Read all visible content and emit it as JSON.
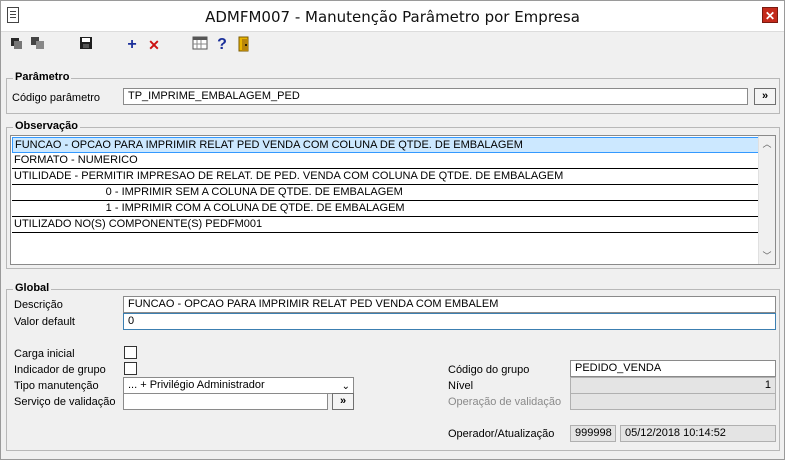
{
  "window": {
    "title": "ADMFM007 - Manutenção Parâmetro por Empresa",
    "close_glyph": "✕"
  },
  "toolbar": {
    "icons": [
      "first-record-icon",
      "copy-icon",
      "save-icon",
      "add-icon",
      "delete-icon",
      "calendar-icon",
      "help-icon",
      "exit-door-icon"
    ],
    "add_glyph": "+",
    "delete_glyph": "✕",
    "help_glyph": "?"
  },
  "parametro": {
    "group_label": "Parâmetro",
    "codigo_label": "Código parâmetro",
    "codigo_value": "TP_IMPRIME_EMBALAGEM_PED",
    "lookup_label": "»"
  },
  "observacao": {
    "group_label": "Observação",
    "rows": [
      "FUNCAO - OPCAO PARA IMPRIMIR RELAT  PED VENDA COM COLUNA DE QTDE. DE EMBALAGEM",
      "FORMATO - NUMERICO",
      "UTILIDADE - PERMITIR IMPRESAO DE RELAT. DE PED. VENDA COM COLUNA DE QTDE. DE EMBALAGEM",
      "                              0 - IMPRIMIR SEM A COLUNA DE QTDE. DE EMBALAGEM",
      "                              1 - IMPRIMIR COM A COLUNA DE QTDE. DE EMBALAGEM",
      "UTILIZADO NO(S) COMPONENTE(S) PEDFM001"
    ],
    "scroll_up": "︿",
    "scroll_down": "﹀"
  },
  "global": {
    "group_label": "Global",
    "descricao_label": "Descrição",
    "descricao_value": "FUNCAO - OPCAO PARA IMPRIMIR RELAT  PED VENDA COM EMBALEM",
    "valor_default_label": "Valor default",
    "valor_default_value": "0",
    "carga_inicial_label": "Carga inicial",
    "indicador_grupo_label": "Indicador de grupo",
    "tipo_manutencao_label": "Tipo manutenção",
    "tipo_manutencao_value": "... + Privilégio Administrador",
    "servico_validacao_label": "Serviço de validação",
    "servico_validacao_value": "",
    "servico_lookup_label": "»",
    "codigo_grupo_label": "Código do grupo",
    "codigo_grupo_value": "PEDIDO_VENDA",
    "nivel_label": "Nível",
    "nivel_value": "1",
    "operacao_validacao_label": "Operação de validação",
    "operacao_validacao_value": "",
    "operador_label": "Operador/Atualização",
    "operador_value": "999998",
    "atualizacao_value": "05/12/2018 10:14:52",
    "dropdown_glyph": "⌄"
  }
}
